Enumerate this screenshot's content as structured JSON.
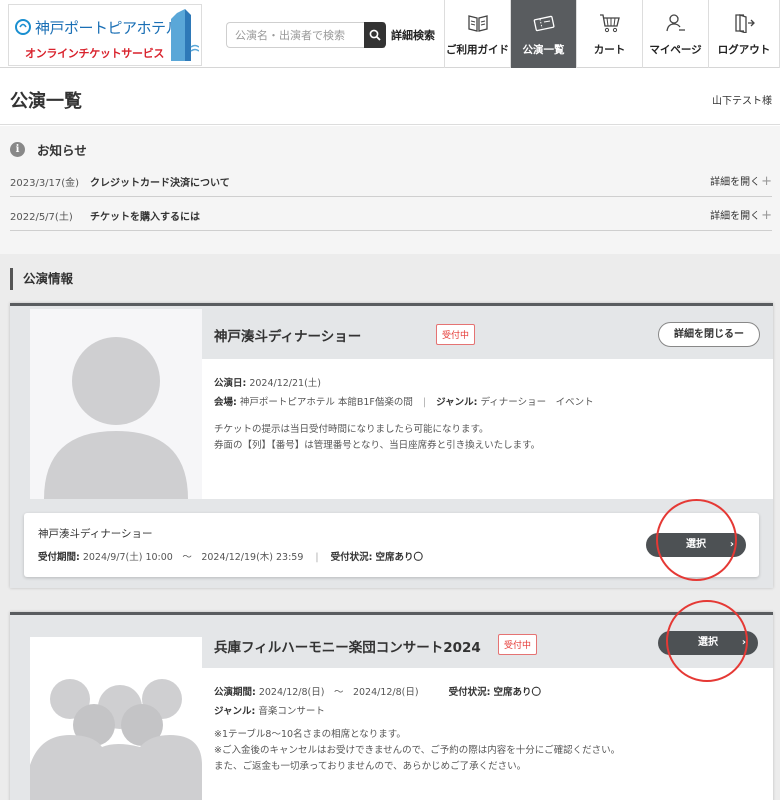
{
  "header": {
    "logo_title": "神戸ポートピアホテル",
    "logo_subtitle": "オンラインチケットサービス",
    "search_placeholder": "公演名・出演者で検索",
    "advanced_search": "詳細検索",
    "nav": [
      {
        "label": "ご利用ガイド",
        "icon": "book-icon",
        "active": false
      },
      {
        "label": "公演一覧",
        "icon": "ticket-icon",
        "active": true
      },
      {
        "label": "カート",
        "icon": "cart-icon",
        "active": false
      },
      {
        "label": "マイページ",
        "icon": "user-icon",
        "active": false
      },
      {
        "label": "ログアウト",
        "icon": "logout-icon",
        "active": false
      }
    ]
  },
  "page": {
    "title": "公演一覧",
    "user": "山下テスト様"
  },
  "notices": {
    "title": "お知らせ",
    "items": [
      {
        "date": "2023/3/17(金)",
        "text": "クレジットカード決済について",
        "open_label": "詳細を開く"
      },
      {
        "date": "2022/5/7(土)",
        "text": "チケットを購入するには",
        "open_label": "詳細を開く"
      }
    ]
  },
  "section": {
    "title": "公演情報"
  },
  "events": [
    {
      "name": "神戸湊斗ディナーショー",
      "badge": "受付中",
      "detail_toggle": "詳細を閉じるー",
      "date_label": "公演日:",
      "date": "2024/12/21(土)",
      "venue_label": "会場:",
      "venue": "神戸ポートピアホテル 本館B1F偕楽の間",
      "genre_label": "ジャンル:",
      "genre": "ディナーショー　イベント",
      "desc1": "チケットの提示は当日受付時間になりましたら可能になります。",
      "desc2": "券面の【列】【番号】は管理番号となり、当日座席券と引き換えいたします。",
      "sub": {
        "name": "神戸湊斗ディナーショー",
        "period_label": "受付期間:",
        "period": "2024/9/7(土) 10:00　～　2024/12/19(木) 23:59",
        "status_label": "受付状況:",
        "status": "空席あり〇",
        "select": "選択"
      }
    },
    {
      "name": "兵庫フィルハーモニー楽団コンサート2024",
      "badge": "受付中",
      "select": "選択",
      "period_label": "公演期間:",
      "period": "2024/12/8(日)　～　2024/12/8(日)",
      "status_label": "受付状況:",
      "status": "空席あり〇",
      "genre_label": "ジャンル:",
      "genre": "音楽コンサート",
      "note1": "※1テーブル8～10名さまの相席となります。",
      "note2": "※ご入金後のキャンセルはお受けできませんので、ご予約の際は内容を十分にご確認ください。",
      "note3": "また、ご返金も一切承っておりませんので、あらかじめご了承ください。"
    }
  ],
  "colors": {
    "accent_dark": "#595c5f",
    "badge_red": "#e53935",
    "annotation_red": "#e53935"
  }
}
